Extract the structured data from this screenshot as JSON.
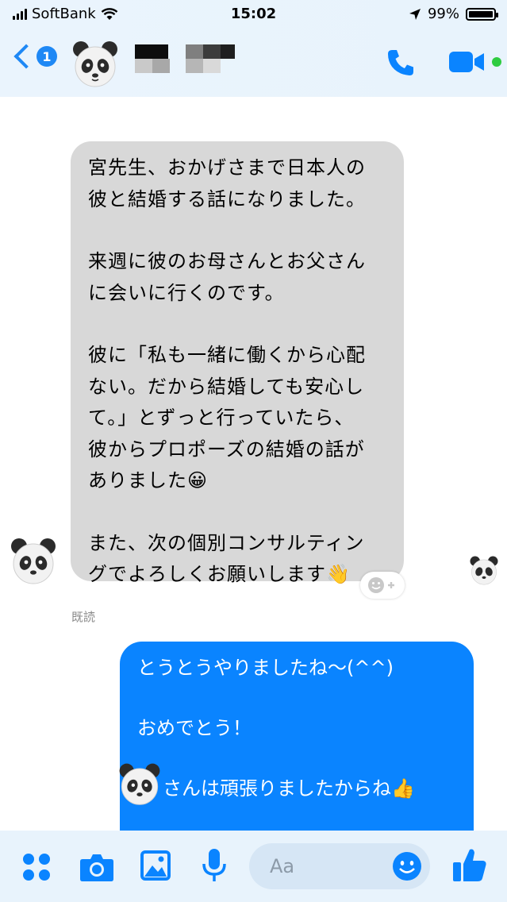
{
  "status_bar": {
    "carrier": "SoftBank",
    "time": "15:02",
    "battery": "99%",
    "battery_level": 0.99
  },
  "header": {
    "back_badge": "1"
  },
  "messages": {
    "incoming": [
      "宮先生、おかげさまで日本人の\n彼と結婚する話になりました。",
      "来週に彼のお母さんとお父さん\nに会いに行くのです。",
      "彼に「私も一緒に働くから心配\nない。だから結婚しても安心し\nて。」とずっと行っていたら、\n彼からプロポーズの結婚の話が\nありました😀",
      "また、次の個別コンサルティン\nグでよろしくお願いします👋"
    ],
    "read_status": "既読",
    "outgoing": {
      "line1": "とうとうやりましたね〜(^^)",
      "line2": "おめでとう！",
      "line3": "さんは頑張りましたからね👍"
    }
  },
  "composer": {
    "placeholder": "Aa"
  },
  "colors": {
    "accent": "#0a84ff",
    "incoming_bubble": "#d8d8d8",
    "header_bg": "#eaf4fd"
  }
}
